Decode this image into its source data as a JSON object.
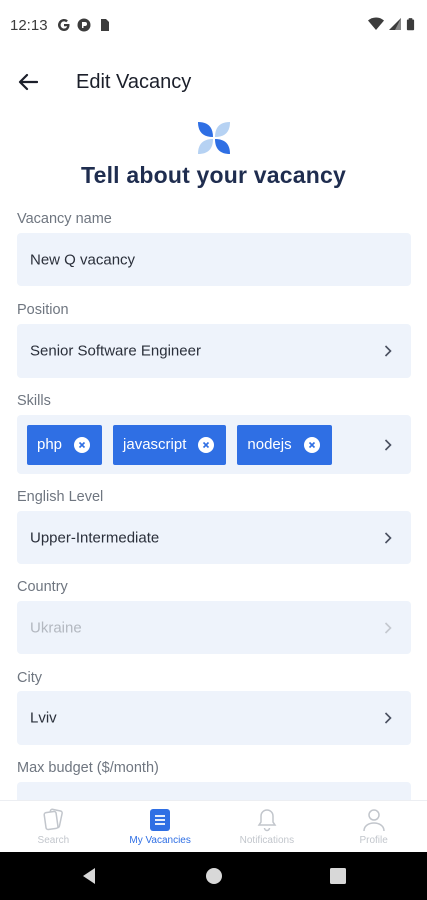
{
  "status_bar": {
    "time": "12:13"
  },
  "header": {
    "title": "Edit Vacancy"
  },
  "headline": "Tell about your vacancy",
  "form": {
    "vacancy_name": {
      "label": "Vacancy name",
      "value": "New Q vacancy"
    },
    "position": {
      "label": "Position",
      "value": "Senior Software Engineer"
    },
    "skills": {
      "label": "Skills",
      "chips": [
        "php",
        "javascript",
        "nodejs"
      ]
    },
    "english_level": {
      "label": "English Level",
      "value": "Upper-Intermediate"
    },
    "country": {
      "label": "Country",
      "value": "Ukraine"
    },
    "city": {
      "label": "City",
      "value": "Lviv"
    },
    "max_budget": {
      "label": "Max budget ($/month)",
      "value": ""
    }
  },
  "bottom_nav": {
    "items": [
      {
        "label": "Search",
        "icon": "cards-icon"
      },
      {
        "label": "My Vacancies",
        "icon": "document-icon"
      },
      {
        "label": "Notifications",
        "icon": "bell-icon"
      },
      {
        "label": "Profile",
        "icon": "person-icon"
      }
    ],
    "active_index": 1
  },
  "colors": {
    "accent": "#2f6fe4",
    "field_bg": "#eef3fb",
    "headline": "#1f2d4f"
  }
}
